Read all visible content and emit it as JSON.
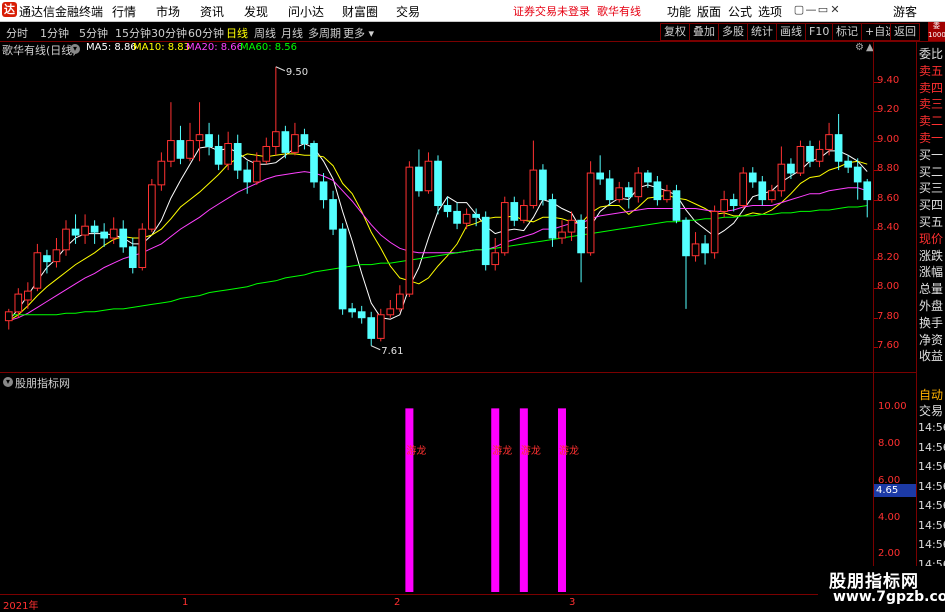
{
  "titlebar": {
    "logo": "达",
    "app_title": "通达信金融终端",
    "menus": [
      "行情",
      "市场",
      "资讯",
      "发现",
      "问小达",
      "财富圈",
      "交易"
    ],
    "notice": "证券交易未登录",
    "notice2": "歌华有线",
    "right_menus": [
      "功能",
      "版面",
      "公式",
      "选项"
    ],
    "user": "游客",
    "controls": [
      "▢",
      "—",
      "▭",
      "✕"
    ]
  },
  "toolbar": {
    "periods": [
      "分时",
      "1分钟",
      "5分钟",
      "15分钟",
      "30分钟",
      "60分钟",
      "日线",
      "周线",
      "月线",
      "多周期",
      "更多"
    ],
    "active_period": "日线",
    "right_buttons": [
      "复权",
      "叠加",
      "多股",
      "统计",
      "画线",
      "F10",
      "标记",
      "+自选",
      "返回"
    ]
  },
  "main_chart": {
    "stock_label": "歌华有线(日线)",
    "legend": [
      {
        "name": "MA5",
        "value": "8.86",
        "color": "#ffffff"
      },
      {
        "name": "MA10",
        "value": "8.83",
        "color": "#ffff00"
      },
      {
        "name": "MA20",
        "value": "8.66",
        "color": "#ff40ff"
      },
      {
        "name": "MA60",
        "value": "8.56",
        "color": "#00ff00"
      }
    ],
    "high_label": "9.50",
    "low_label": "7.61"
  },
  "indicator": {
    "title": "股朋指标网",
    "signal_label": "游龙",
    "current_value": "4.65"
  },
  "dates": {
    "year": "2021年",
    "m1": "1",
    "m2": "2",
    "m3": "3"
  },
  "right_panel": {
    "top_badge": "委比",
    "labels": [
      "委比",
      "卖五",
      "卖四",
      "卖三",
      "卖二",
      "卖一",
      "买一",
      "买二",
      "买三",
      "买四",
      "买五",
      "现价",
      "涨跌",
      "涨幅",
      "总量",
      "外盘",
      "换手",
      "净资",
      "收益"
    ],
    "bottom": [
      "自动",
      "交易"
    ],
    "times": [
      "14:56",
      "14:56",
      "14:56",
      "14:56",
      "14:56",
      "14:56",
      "14:56",
      "14:56",
      "14:56",
      "14:56"
    ]
  },
  "watermark": {
    "line1": "股朋指标网",
    "line2": "www.7gpzb.com"
  },
  "chart_data": [
    {
      "type": "candlestick",
      "title": "歌华有线(日线)",
      "ylim": [
        7.5,
        9.6
      ],
      "yticks": [
        7.6,
        7.8,
        8.0,
        8.2,
        8.4,
        8.6,
        8.8,
        9.0,
        9.2,
        9.4
      ],
      "ytick_labels": [
        "7.60",
        "7.80",
        "8.00",
        "8.20",
        "8.40",
        "8.60",
        "8.80",
        "9.00",
        "9.20",
        "9.40"
      ],
      "candles": [
        [
          7.78,
          7.84,
          7.72,
          7.86
        ],
        [
          7.84,
          7.96,
          7.8,
          8.0
        ],
        [
          7.92,
          7.98,
          7.86,
          8.04
        ],
        [
          8.0,
          8.24,
          7.98,
          8.3
        ],
        [
          8.22,
          8.18,
          8.1,
          8.26
        ],
        [
          8.18,
          8.26,
          8.14,
          8.34
        ],
        [
          8.26,
          8.4,
          8.22,
          8.46
        ],
        [
          8.4,
          8.36,
          8.3,
          8.5
        ],
        [
          8.36,
          8.42,
          8.3,
          8.5
        ],
        [
          8.42,
          8.38,
          8.3,
          8.46
        ],
        [
          8.38,
          8.34,
          8.28,
          8.44
        ],
        [
          8.34,
          8.4,
          8.3,
          8.48
        ],
        [
          8.4,
          8.28,
          8.24,
          8.46
        ],
        [
          8.28,
          8.14,
          8.1,
          8.34
        ],
        [
          8.14,
          8.4,
          8.12,
          8.44
        ],
        [
          8.4,
          8.7,
          8.38,
          8.74
        ],
        [
          8.7,
          8.86,
          8.66,
          8.92
        ],
        [
          8.86,
          9.0,
          8.82,
          9.26
        ],
        [
          9.0,
          8.88,
          8.84,
          9.1
        ],
        [
          8.88,
          9.0,
          8.86,
          9.12
        ],
        [
          9.0,
          9.04,
          8.86,
          9.26
        ],
        [
          9.04,
          8.96,
          8.9,
          9.12
        ],
        [
          8.96,
          8.84,
          8.8,
          9.04
        ],
        [
          8.84,
          8.98,
          8.8,
          9.06
        ],
        [
          8.98,
          8.8,
          8.74,
          9.04
        ],
        [
          8.8,
          8.72,
          8.64,
          8.86
        ],
        [
          8.72,
          8.86,
          8.7,
          8.92
        ],
        [
          8.86,
          8.96,
          8.84,
          9.02
        ],
        [
          8.96,
          9.06,
          8.9,
          9.5
        ],
        [
          9.06,
          8.92,
          8.88,
          9.1
        ],
        [
          8.92,
          9.04,
          8.9,
          9.12
        ],
        [
          9.04,
          8.98,
          8.94,
          9.08
        ],
        [
          8.98,
          8.72,
          8.68,
          9.0
        ],
        [
          8.72,
          8.6,
          8.54,
          8.78
        ],
        [
          8.6,
          8.4,
          8.36,
          8.66
        ],
        [
          8.4,
          7.86,
          7.82,
          8.44
        ],
        [
          7.86,
          7.84,
          7.8,
          7.9
        ],
        [
          7.84,
          7.8,
          7.76,
          7.88
        ],
        [
          7.8,
          7.66,
          7.61,
          7.84
        ],
        [
          7.66,
          7.82,
          7.64,
          7.86
        ],
        [
          7.82,
          7.86,
          7.8,
          7.92
        ],
        [
          7.86,
          7.96,
          7.84,
          8.02
        ],
        [
          7.96,
          8.82,
          7.94,
          8.86
        ],
        [
          8.82,
          8.66,
          8.62,
          8.94
        ],
        [
          8.66,
          8.86,
          8.64,
          8.92
        ],
        [
          8.86,
          8.56,
          8.5,
          8.9
        ],
        [
          8.56,
          8.52,
          8.48,
          8.62
        ],
        [
          8.52,
          8.44,
          8.4,
          8.58
        ],
        [
          8.44,
          8.5,
          8.4,
          8.54
        ],
        [
          8.5,
          8.48,
          8.42,
          8.54
        ],
        [
          8.48,
          8.16,
          8.12,
          8.52
        ],
        [
          8.16,
          8.24,
          8.12,
          8.34
        ],
        [
          8.24,
          8.58,
          8.22,
          8.62
        ],
        [
          8.58,
          8.46,
          8.42,
          8.62
        ],
        [
          8.46,
          8.56,
          8.44,
          8.6
        ],
        [
          8.56,
          8.8,
          8.54,
          9.0
        ],
        [
          8.8,
          8.6,
          8.56,
          8.84
        ],
        [
          8.6,
          8.34,
          8.28,
          8.64
        ],
        [
          8.34,
          8.38,
          8.3,
          8.46
        ],
        [
          8.38,
          8.46,
          8.32,
          8.52
        ],
        [
          8.46,
          8.24,
          8.04,
          8.5
        ],
        [
          8.24,
          8.78,
          8.22,
          8.86
        ],
        [
          8.78,
          8.74,
          8.7,
          8.9
        ],
        [
          8.74,
          8.6,
          8.56,
          8.8
        ],
        [
          8.6,
          8.68,
          8.58,
          8.72
        ],
        [
          8.68,
          8.62,
          8.54,
          8.72
        ],
        [
          8.62,
          8.78,
          8.58,
          8.82
        ],
        [
          8.78,
          8.72,
          8.68,
          8.8
        ],
        [
          8.72,
          8.6,
          8.56,
          8.76
        ],
        [
          8.6,
          8.66,
          8.58,
          8.7
        ],
        [
          8.66,
          8.46,
          8.44,
          8.7
        ],
        [
          8.46,
          8.22,
          7.86,
          8.48
        ],
        [
          8.22,
          8.3,
          8.18,
          8.38
        ],
        [
          8.3,
          8.24,
          8.16,
          8.36
        ],
        [
          8.24,
          8.52,
          8.2,
          8.56
        ],
        [
          8.52,
          8.6,
          8.48,
          8.66
        ],
        [
          8.6,
          8.56,
          8.52,
          8.64
        ],
        [
          8.56,
          8.78,
          8.54,
          8.82
        ],
        [
          8.78,
          8.72,
          8.68,
          8.82
        ],
        [
          8.72,
          8.6,
          8.56,
          8.76
        ],
        [
          8.6,
          8.66,
          8.58,
          8.7
        ],
        [
          8.66,
          8.84,
          8.62,
          8.96
        ],
        [
          8.84,
          8.78,
          8.74,
          8.88
        ],
        [
          8.78,
          8.96,
          8.76,
          9.0
        ],
        [
          8.96,
          8.86,
          8.82,
          9.0
        ],
        [
          8.86,
          8.94,
          8.82,
          9.0
        ],
        [
          8.94,
          9.04,
          8.9,
          9.12
        ],
        [
          9.04,
          8.86,
          8.8,
          9.18
        ],
        [
          8.86,
          8.82,
          8.78,
          8.9
        ],
        [
          8.82,
          8.72,
          8.6,
          8.88
        ],
        [
          8.72,
          8.6,
          8.48,
          8.74
        ]
      ],
      "ma": {
        "MA5": [
          7.78,
          7.86,
          7.95,
          8.05,
          8.14,
          8.2,
          8.28,
          8.34,
          8.37,
          8.37,
          8.37,
          8.36,
          8.34,
          8.3,
          8.3,
          8.36,
          8.46,
          8.61,
          8.73,
          8.84,
          8.95,
          8.96,
          8.93,
          8.95,
          8.92,
          8.87,
          8.84,
          8.84,
          8.85,
          8.9,
          8.95,
          8.98,
          8.95,
          8.86,
          8.74,
          8.52,
          8.32,
          8.1,
          7.9,
          7.8,
          7.79,
          7.82,
          8.01,
          8.14,
          8.34,
          8.52,
          8.62,
          8.58,
          8.58,
          8.5,
          8.42,
          8.37,
          8.39,
          8.4,
          8.39,
          8.48,
          8.6,
          8.58,
          8.54,
          8.51,
          8.4,
          8.42,
          8.52,
          8.57,
          8.61,
          8.6,
          8.68,
          8.7,
          8.68,
          8.66,
          8.63,
          8.53,
          8.45,
          8.4,
          8.35,
          8.39,
          8.44,
          8.53,
          8.62,
          8.64,
          8.66,
          8.72,
          8.76,
          8.8,
          8.86,
          8.88,
          8.93,
          8.93,
          8.9,
          8.86,
          8.79
        ],
        "MA10": [
          7.78,
          7.82,
          7.88,
          7.95,
          8.01,
          8.06,
          8.11,
          8.16,
          8.2,
          8.24,
          8.29,
          8.33,
          8.35,
          8.34,
          8.34,
          8.36,
          8.4,
          8.47,
          8.55,
          8.6,
          8.65,
          8.71,
          8.77,
          8.84,
          8.88,
          8.91,
          8.9,
          8.89,
          8.9,
          8.91,
          8.91,
          8.9,
          8.9,
          8.89,
          8.83,
          8.71,
          8.64,
          8.52,
          8.38,
          8.27,
          8.15,
          8.07,
          8.05,
          8.03,
          8.07,
          8.15,
          8.22,
          8.3,
          8.42,
          8.44,
          8.47,
          8.48,
          8.48,
          8.49,
          8.46,
          8.45,
          8.48,
          8.48,
          8.47,
          8.45,
          8.44,
          8.51,
          8.55,
          8.56,
          8.56,
          8.5,
          8.55,
          8.61,
          8.62,
          8.63,
          8.61,
          8.6,
          8.57,
          8.54,
          8.5,
          8.51,
          8.49,
          8.49,
          8.51,
          8.5,
          8.53,
          8.58,
          8.64,
          8.71,
          8.75,
          8.76,
          8.8,
          8.82,
          8.85,
          8.86,
          8.84
        ],
        "MA20": [
          7.78,
          7.8,
          7.83,
          7.87,
          7.91,
          7.95,
          7.99,
          8.03,
          8.07,
          8.1,
          8.14,
          8.17,
          8.2,
          8.22,
          8.24,
          8.27,
          8.3,
          8.35,
          8.4,
          8.44,
          8.48,
          8.53,
          8.57,
          8.61,
          8.65,
          8.68,
          8.71,
          8.74,
          8.76,
          8.77,
          8.78,
          8.79,
          8.78,
          8.76,
          8.73,
          8.66,
          8.59,
          8.51,
          8.43,
          8.36,
          8.31,
          8.27,
          8.25,
          8.24,
          8.24,
          8.24,
          8.24,
          8.24,
          8.25,
          8.26,
          8.26,
          8.28,
          8.31,
          8.33,
          8.35,
          8.37,
          8.4,
          8.4,
          8.42,
          8.44,
          8.44,
          8.47,
          8.49,
          8.5,
          8.51,
          8.52,
          8.53,
          8.54,
          8.54,
          8.54,
          8.54,
          8.54,
          8.54,
          8.53,
          8.52,
          8.52,
          8.53,
          8.55,
          8.56,
          8.56,
          8.56,
          8.58,
          8.6,
          8.62,
          8.64,
          8.64,
          8.66,
          8.67,
          8.68,
          8.68,
          8.66
        ],
        "MA60": [
          7.82,
          7.82,
          7.82,
          7.82,
          7.82,
          7.82,
          7.83,
          7.83,
          7.84,
          7.84,
          7.85,
          7.86,
          7.86,
          7.87,
          7.88,
          7.89,
          7.9,
          7.91,
          7.93,
          7.94,
          7.95,
          7.97,
          7.98,
          7.99,
          8.0,
          8.01,
          8.03,
          8.04,
          8.05,
          8.07,
          8.08,
          8.09,
          8.11,
          8.12,
          8.13,
          8.14,
          8.15,
          8.16,
          8.16,
          8.17,
          8.17,
          8.18,
          8.19,
          8.2,
          8.21,
          8.22,
          8.23,
          8.24,
          8.25,
          8.26,
          8.26,
          8.27,
          8.28,
          8.29,
          8.3,
          8.31,
          8.32,
          8.33,
          8.34,
          8.35,
          8.36,
          8.37,
          8.38,
          8.39,
          8.4,
          8.41,
          8.42,
          8.43,
          8.44,
          8.45,
          8.45,
          8.46,
          8.46,
          8.47,
          8.47,
          8.48,
          8.48,
          8.49,
          8.49,
          8.5,
          8.5,
          8.51,
          8.51,
          8.52,
          8.52,
          8.53,
          8.53,
          8.54,
          8.55,
          8.55,
          8.56
        ]
      }
    },
    {
      "type": "bar",
      "title": "股朋指标网",
      "ylim": [
        0,
        11
      ],
      "yticks": [
        2,
        4,
        6,
        8,
        10
      ],
      "ytick_labels": [
        "2.00",
        "4.00",
        "6.00",
        "8.00",
        "10.00"
      ],
      "signal_indices": [
        42,
        51,
        54,
        58
      ],
      "signal_values": [
        10,
        10,
        10,
        10
      ],
      "signal_text": "游龙"
    }
  ]
}
